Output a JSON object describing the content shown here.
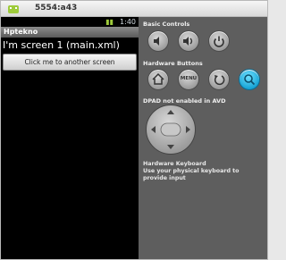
{
  "window": {
    "title": "5554:a43"
  },
  "statusbar": {
    "time": "1:40"
  },
  "app": {
    "title": "Hptekno",
    "screen_text": "I'm screen 1 (main.xml)",
    "button_label": "Click me to another screen"
  },
  "controls": {
    "basic_label": "Basic Controls",
    "hardware_label": "Hardware Buttons",
    "menu_label": "MENU",
    "dpad_label": "DPAD not enabled in AVD",
    "keyboard_title": "Hardware Keyboard",
    "keyboard_desc": "Use your physical keyboard to provide input"
  },
  "icons": [
    "android-icon",
    "volume-down-icon",
    "volume-up-icon",
    "power-icon",
    "home-icon",
    "menu-icon",
    "back-icon",
    "search-icon",
    "dpad"
  ],
  "colors": {
    "search_button": "#19a5d6",
    "panel": "#5e5e5e",
    "screen": "#000000"
  }
}
